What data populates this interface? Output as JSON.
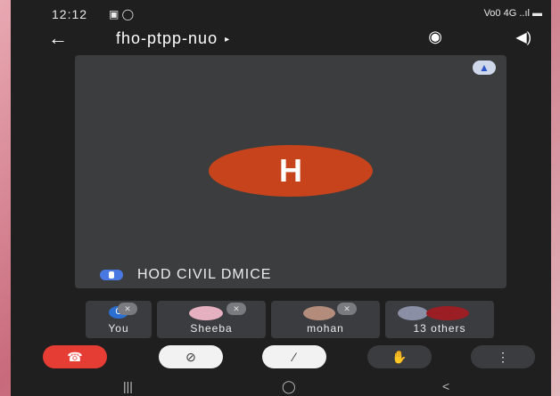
{
  "status_bar": {
    "time": "12:12",
    "indicators": "▣ ◯",
    "right": "Vo0 4G ..ıl ▬"
  },
  "header": {
    "back_icon": "←",
    "meeting_code": "fho-ptpp-nuo",
    "caret": "▸",
    "switch_camera_icon": "◉",
    "audio_icon": "◀)"
  },
  "stage": {
    "alert_icon": "▲",
    "avatar_letter": "H",
    "presenter_name": "HOD CIVIL DMICE"
  },
  "participants": [
    {
      "label": "You",
      "initial": "C"
    },
    {
      "label": "Sheeba"
    },
    {
      "label": "mohan"
    },
    {
      "label": "13 others"
    }
  ],
  "controls": {
    "end_call_icon": "☎",
    "camera_off_icon": "⊘",
    "mic_off_icon": "⁄",
    "raise_hand_icon": "✋",
    "more_icon": "⋮"
  },
  "nav": {
    "recent": "|||",
    "home": "◯",
    "back": "<"
  },
  "colors": {
    "end_call": "#e53c34",
    "avatar": "#c7431c",
    "stage": "#3c3d3f",
    "background": "#1f1f20"
  }
}
